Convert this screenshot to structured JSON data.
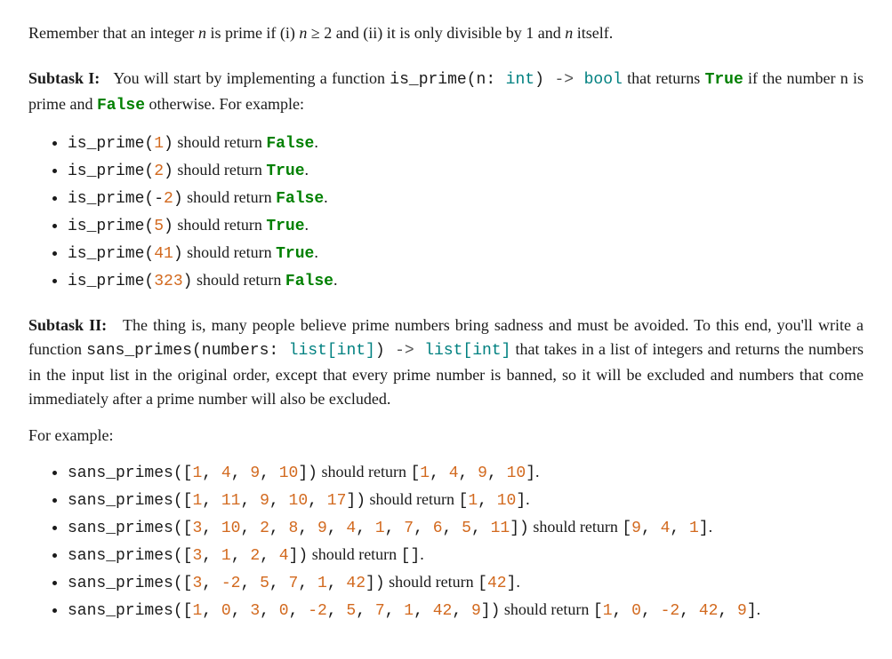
{
  "intro": "Remember that an integer n is prime if (i) n ≥ 2 and (ii) it is only divisible by 1 and n itself.",
  "subtask1": {
    "label": "Subtask I:",
    "text_pre": "You will start by implementing a function ",
    "sig_name": "is_prime(n: ",
    "sig_type": "int",
    "sig_close": ")",
    "sig_arrow": " -> ",
    "sig_ret": "bool",
    "text_mid": " that returns ",
    "true": "True",
    "text_mid2": " if the number n is prime and ",
    "false": "False",
    "text_post": " otherwise. For example:",
    "items": [
      {
        "call": "is_prime(",
        "arg": "1",
        "close": ")",
        "ret": "False"
      },
      {
        "call": "is_prime(",
        "arg": "2",
        "close": ")",
        "ret": "True"
      },
      {
        "call": "is_prime(-",
        "arg": "2",
        "close": ")",
        "ret": "False"
      },
      {
        "call": "is_prime(",
        "arg": "5",
        "close": ")",
        "ret": "True"
      },
      {
        "call": "is_prime(",
        "arg": "41",
        "close": ")",
        "ret": "True"
      },
      {
        "call": "is_prime(",
        "arg": "323",
        "close": ")",
        "ret": "False"
      }
    ],
    "should_return": " should return "
  },
  "subtask2": {
    "label": "Subtask II:",
    "text_pre": "The thing is, many people believe prime numbers bring sadness and must be avoided. To this end, you'll write a function ",
    "sig_name": "sans_primes(numbers: ",
    "sig_type": "list[int]",
    "sig_close": ")",
    "sig_arrow": " -> ",
    "sig_ret": "list[int]",
    "text_post": " that takes in a list of integers and returns the numbers in the input list in the original order, except that every prime number is banned, so it will be excluded and numbers that come immediately after a prime number will also be excluded.",
    "forex": "For example:",
    "should_return": " should return ",
    "items": [
      {
        "in": "[1, 4, 9, 10]",
        "out": "[1, 4, 9, 10]"
      },
      {
        "in": "[1, 11, 9, 10, 17]",
        "out": "[1, 10]"
      },
      {
        "in": "[3, 10, 2, 8, 9, 4, 1, 7, 6, 5, 11]",
        "out": "[9, 4, 1]"
      },
      {
        "in": "[3, 1, 2, 4]",
        "out": "[]"
      },
      {
        "in": "[3, -2, 5, 7, 1, 42]",
        "out": "[42]"
      },
      {
        "in": "[1, 0, 3, 0, -2, 5, 7, 1, 42, 9]",
        "out": "[1, 0, -2, 42, 9]"
      }
    ],
    "call_name": "sans_primes("
  },
  "period": "."
}
